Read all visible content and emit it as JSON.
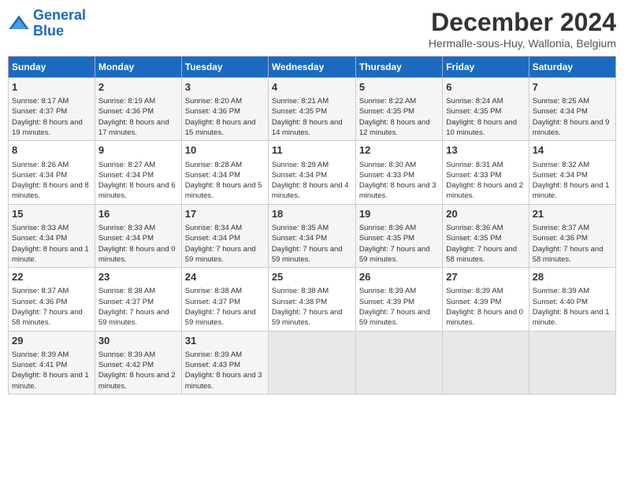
{
  "header": {
    "logo_line1": "General",
    "logo_line2": "Blue",
    "month_title": "December 2024",
    "subtitle": "Hermalle-sous-Huy, Wallonia, Belgium"
  },
  "days_of_week": [
    "Sunday",
    "Monday",
    "Tuesday",
    "Wednesday",
    "Thursday",
    "Friday",
    "Saturday"
  ],
  "weeks": [
    [
      {
        "day": "1",
        "info": "Sunrise: 8:17 AM\nSunset: 4:37 PM\nDaylight: 8 hours and 19 minutes."
      },
      {
        "day": "2",
        "info": "Sunrise: 8:19 AM\nSunset: 4:36 PM\nDaylight: 8 hours and 17 minutes."
      },
      {
        "day": "3",
        "info": "Sunrise: 8:20 AM\nSunset: 4:36 PM\nDaylight: 8 hours and 15 minutes."
      },
      {
        "day": "4",
        "info": "Sunrise: 8:21 AM\nSunset: 4:35 PM\nDaylight: 8 hours and 14 minutes."
      },
      {
        "day": "5",
        "info": "Sunrise: 8:22 AM\nSunset: 4:35 PM\nDaylight: 8 hours and 12 minutes."
      },
      {
        "day": "6",
        "info": "Sunrise: 8:24 AM\nSunset: 4:35 PM\nDaylight: 8 hours and 10 minutes."
      },
      {
        "day": "7",
        "info": "Sunrise: 8:25 AM\nSunset: 4:34 PM\nDaylight: 8 hours and 9 minutes."
      }
    ],
    [
      {
        "day": "8",
        "info": "Sunrise: 8:26 AM\nSunset: 4:34 PM\nDaylight: 8 hours and 8 minutes."
      },
      {
        "day": "9",
        "info": "Sunrise: 8:27 AM\nSunset: 4:34 PM\nDaylight: 8 hours and 6 minutes."
      },
      {
        "day": "10",
        "info": "Sunrise: 8:28 AM\nSunset: 4:34 PM\nDaylight: 8 hours and 5 minutes."
      },
      {
        "day": "11",
        "info": "Sunrise: 8:29 AM\nSunset: 4:34 PM\nDaylight: 8 hours and 4 minutes."
      },
      {
        "day": "12",
        "info": "Sunrise: 8:30 AM\nSunset: 4:33 PM\nDaylight: 8 hours and 3 minutes."
      },
      {
        "day": "13",
        "info": "Sunrise: 8:31 AM\nSunset: 4:33 PM\nDaylight: 8 hours and 2 minutes."
      },
      {
        "day": "14",
        "info": "Sunrise: 8:32 AM\nSunset: 4:34 PM\nDaylight: 8 hours and 1 minute."
      }
    ],
    [
      {
        "day": "15",
        "info": "Sunrise: 8:33 AM\nSunset: 4:34 PM\nDaylight: 8 hours and 1 minute."
      },
      {
        "day": "16",
        "info": "Sunrise: 8:33 AM\nSunset: 4:34 PM\nDaylight: 8 hours and 0 minutes."
      },
      {
        "day": "17",
        "info": "Sunrise: 8:34 AM\nSunset: 4:34 PM\nDaylight: 7 hours and 59 minutes."
      },
      {
        "day": "18",
        "info": "Sunrise: 8:35 AM\nSunset: 4:34 PM\nDaylight: 7 hours and 59 minutes."
      },
      {
        "day": "19",
        "info": "Sunrise: 8:36 AM\nSunset: 4:35 PM\nDaylight: 7 hours and 59 minutes."
      },
      {
        "day": "20",
        "info": "Sunrise: 8:36 AM\nSunset: 4:35 PM\nDaylight: 7 hours and 58 minutes."
      },
      {
        "day": "21",
        "info": "Sunrise: 8:37 AM\nSunset: 4:36 PM\nDaylight: 7 hours and 58 minutes."
      }
    ],
    [
      {
        "day": "22",
        "info": "Sunrise: 8:37 AM\nSunset: 4:36 PM\nDaylight: 7 hours and 58 minutes."
      },
      {
        "day": "23",
        "info": "Sunrise: 8:38 AM\nSunset: 4:37 PM\nDaylight: 7 hours and 59 minutes."
      },
      {
        "day": "24",
        "info": "Sunrise: 8:38 AM\nSunset: 4:37 PM\nDaylight: 7 hours and 59 minutes."
      },
      {
        "day": "25",
        "info": "Sunrise: 8:38 AM\nSunset: 4:38 PM\nDaylight: 7 hours and 59 minutes."
      },
      {
        "day": "26",
        "info": "Sunrise: 8:39 AM\nSunset: 4:39 PM\nDaylight: 7 hours and 59 minutes."
      },
      {
        "day": "27",
        "info": "Sunrise: 8:39 AM\nSunset: 4:39 PM\nDaylight: 8 hours and 0 minutes."
      },
      {
        "day": "28",
        "info": "Sunrise: 8:39 AM\nSunset: 4:40 PM\nDaylight: 8 hours and 1 minute."
      }
    ],
    [
      {
        "day": "29",
        "info": "Sunrise: 8:39 AM\nSunset: 4:41 PM\nDaylight: 8 hours and 1 minute."
      },
      {
        "day": "30",
        "info": "Sunrise: 8:39 AM\nSunset: 4:42 PM\nDaylight: 8 hours and 2 minutes."
      },
      {
        "day": "31",
        "info": "Sunrise: 8:39 AM\nSunset: 4:43 PM\nDaylight: 8 hours and 3 minutes."
      },
      {
        "day": "",
        "info": ""
      },
      {
        "day": "",
        "info": ""
      },
      {
        "day": "",
        "info": ""
      },
      {
        "day": "",
        "info": ""
      }
    ]
  ]
}
